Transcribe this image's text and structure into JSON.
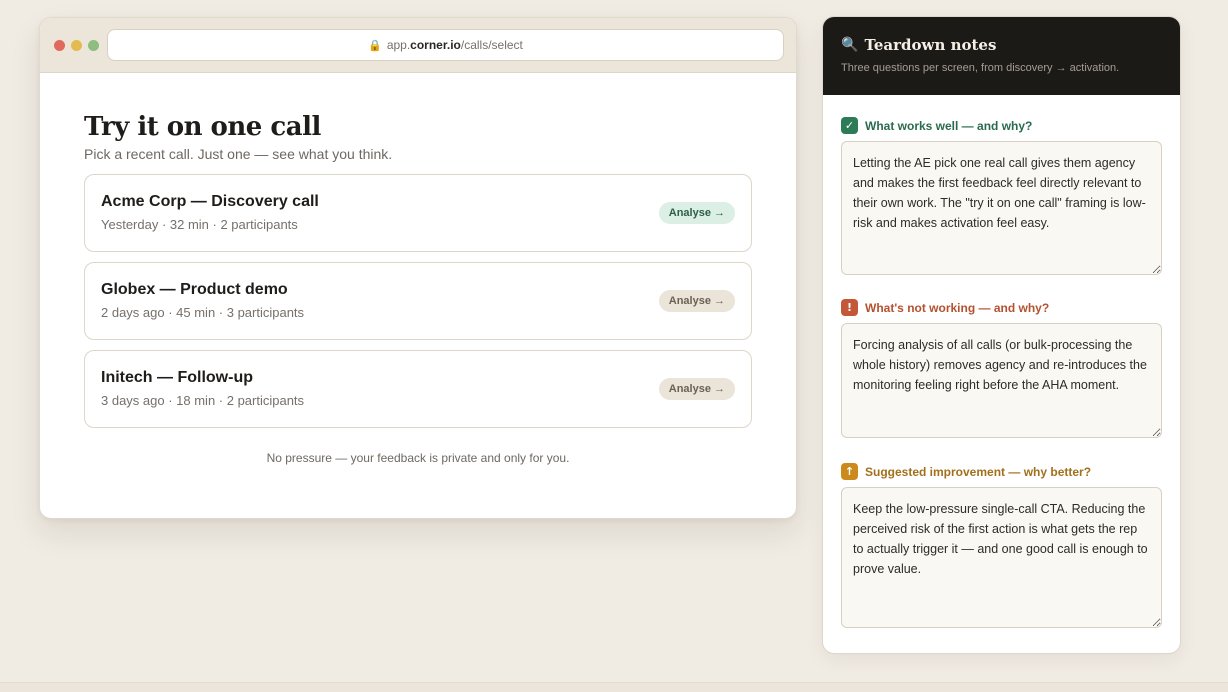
{
  "browser": {
    "url_prefix": "app.",
    "url_domain": "corner.io",
    "url_path": "/calls/select"
  },
  "page": {
    "title": "Try it on one call",
    "subtitle": "Pick a recent call. Just one — see what you think.",
    "footer_note": "No pressure — your feedback is private and only for you."
  },
  "calls": [
    {
      "name": "Acme Corp — Discovery call",
      "meta": "Yesterday · 32 min · 2 participants",
      "button": "Analyse →"
    },
    {
      "name": "Globex — Product demo",
      "meta": "2 days ago · 45 min · 3 participants",
      "button": "Analyse →"
    },
    {
      "name": "Initech — Follow-up",
      "meta": "3 days ago · 18 min · 2 participants",
      "button": "Analyse →"
    }
  ],
  "notes": {
    "title": "Teardown notes",
    "subtitle": "Three questions per screen, from discovery → activation.",
    "questions": [
      {
        "label": "What works well — and why?",
        "icon": "check-icon",
        "answer": "Letting the AE pick one real call gives them agency and makes the first feedback feel directly relevant to their own work. The \"try it on one call\" framing is low-risk and makes activation feel easy."
      },
      {
        "label": "What's not working — and why?",
        "icon": "exclamation-icon",
        "answer": "Forcing analysis of all calls (or bulk-processing the whole history) removes agency and re-introduces the monitoring feeling right before the AHA moment."
      },
      {
        "label": "Suggested improvement — why better?",
        "icon": "arrow-up-icon",
        "answer": "Keep the low-pressure single-call CTA. Reducing the perceived risk of the first action is what gets the rep to actually trigger it — and one good call is enough to prove value."
      }
    ]
  },
  "colors": {
    "background": "#f0ebe3",
    "primary_button": "#dcefe4",
    "good": "#2d7a57",
    "bad": "#c25838",
    "improve": "#cc8a1d",
    "notes_header": "#1c1a17"
  }
}
